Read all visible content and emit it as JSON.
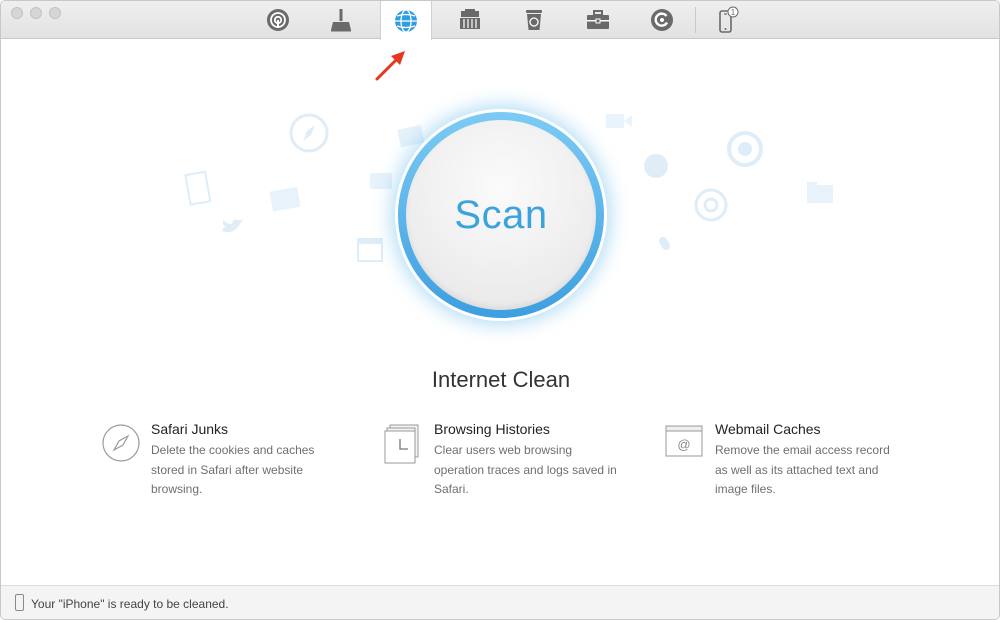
{
  "toolbar": {
    "items": [
      {
        "name": "airbackup-icon"
      },
      {
        "name": "quick-clean-icon"
      },
      {
        "name": "internet-clean-icon",
        "active": true
      },
      {
        "name": "privacy-clean-icon"
      },
      {
        "name": "system-clean-icon"
      },
      {
        "name": "toolbox-icon"
      },
      {
        "name": "update-icon"
      },
      {
        "name": "device-icon",
        "badge": "1"
      }
    ],
    "accent": "#3aa3dd"
  },
  "scan": {
    "label": "Scan"
  },
  "main": {
    "title": "Internet Clean"
  },
  "features": [
    {
      "title": "Safari Junks",
      "desc": "Delete the cookies and caches stored in Safari after website browsing.",
      "icon": "compass-icon"
    },
    {
      "title": "Browsing Histories",
      "desc": "Clear users web browsing operation traces and logs saved in Safari.",
      "icon": "history-pages-icon"
    },
    {
      "title": "Webmail Caches",
      "desc": "Remove the email access record as well as its attached text and image files.",
      "icon": "webmail-icon"
    }
  ],
  "status": {
    "text": "Your \"iPhone\" is ready to be cleaned."
  }
}
